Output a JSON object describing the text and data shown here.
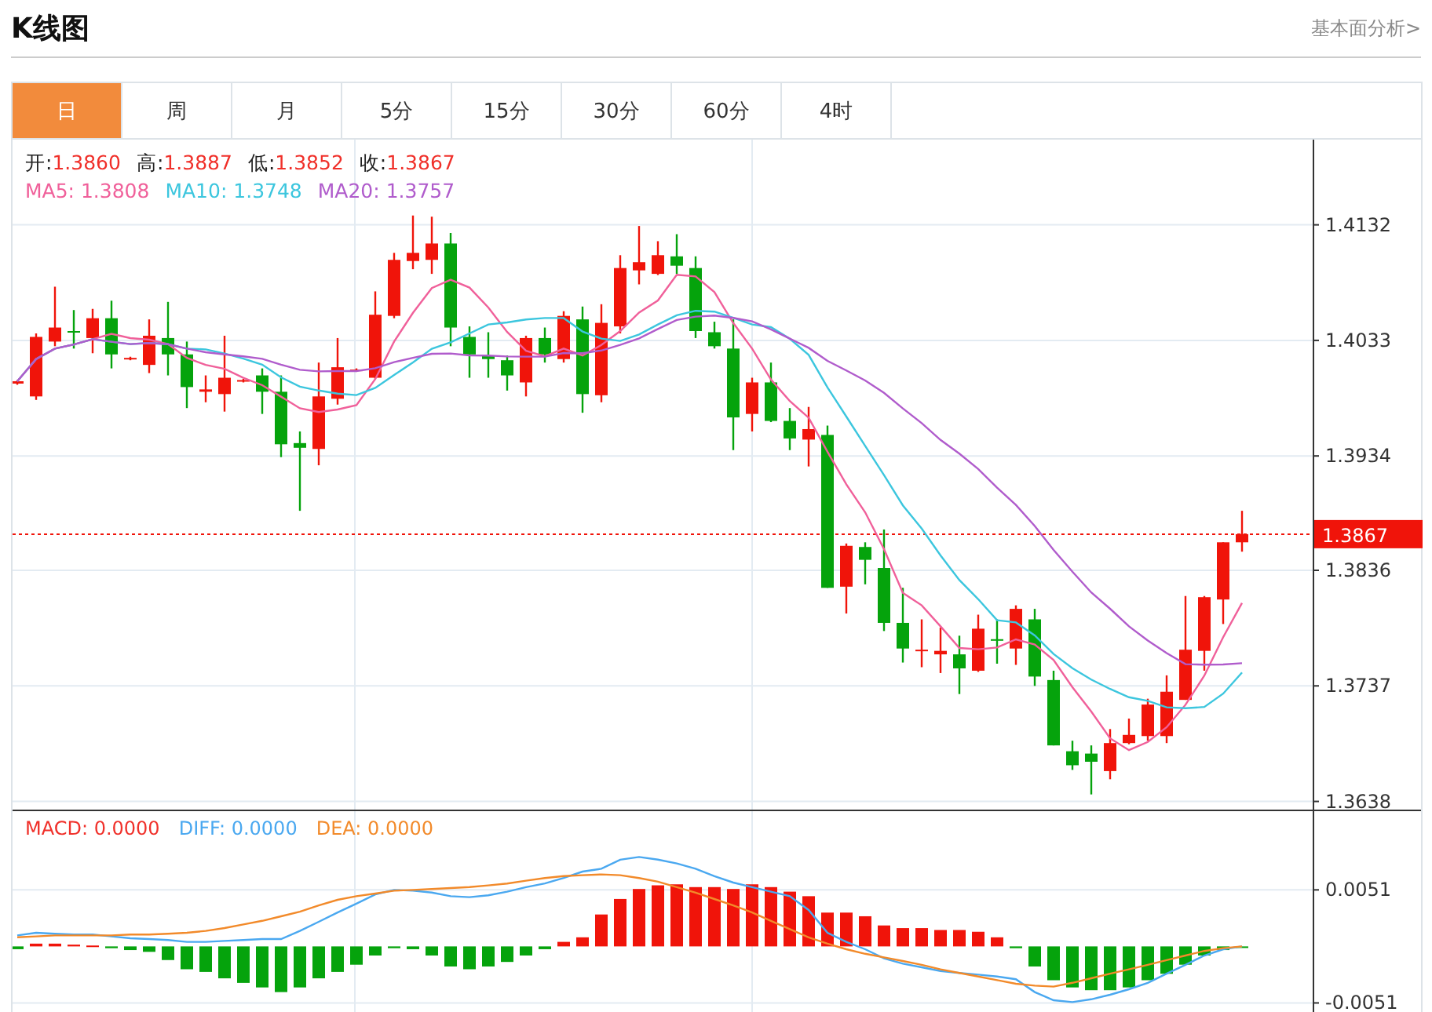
{
  "title": "K线图",
  "link": "基本面分析>",
  "tabs": [
    {
      "label": "日",
      "selected": true
    },
    {
      "label": "周",
      "selected": false
    },
    {
      "label": "月",
      "selected": false
    },
    {
      "label": "5分",
      "selected": false
    },
    {
      "label": "15分",
      "selected": false
    },
    {
      "label": "30分",
      "selected": false
    },
    {
      "label": "60分",
      "selected": false
    },
    {
      "label": "4时",
      "selected": false
    }
  ],
  "quote": [
    {
      "label": "开:",
      "value": "1.3860"
    },
    {
      "label": "高:",
      "value": "1.3887"
    },
    {
      "label": "低:",
      "value": "1.3852"
    },
    {
      "label": "收:",
      "value": "1.3867"
    }
  ],
  "averages": [
    {
      "text": "MA5: 1.3808",
      "color": "#f0609a"
    },
    {
      "text": "MA10: 1.3748",
      "color": "#3cc6de"
    },
    {
      "text": "MA20: 1.3757",
      "color": "#b05ccc"
    }
  ],
  "price_chart": {
    "axis_labels": [
      "1.4132",
      "1.4033",
      "1.3934",
      "1.3836",
      "1.3737",
      "1.3638"
    ],
    "last_price": "1.3867"
  },
  "macd": {
    "legend": [
      {
        "text": "MACD: 0.0000",
        "color": "#f0302a"
      },
      {
        "text": "DIFF: 0.0000",
        "color": "#4aa8f0"
      },
      {
        "text": "DEA: 0.0000",
        "color": "#f28a2a"
      }
    ],
    "axis_labels": [
      "0.0051",
      "-0.0051"
    ]
  }
}
